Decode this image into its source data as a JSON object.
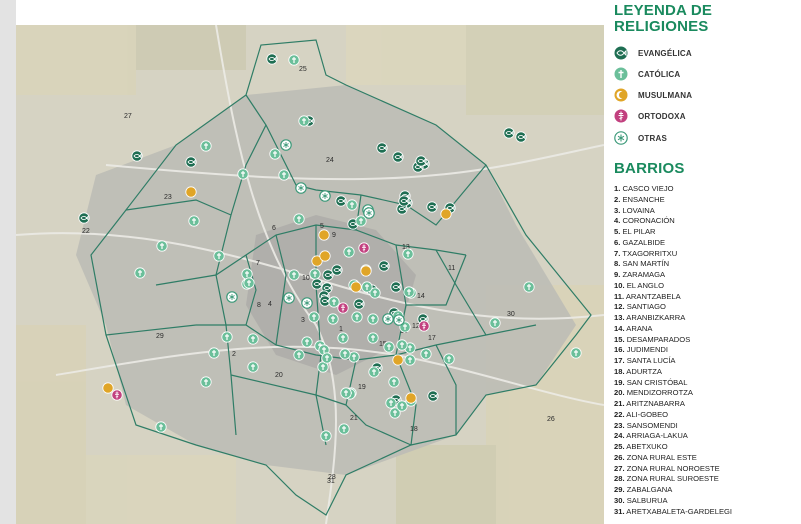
{
  "legend": {
    "title": "LEYENDA DE RELIGIONES",
    "items": [
      {
        "key": "evangelica",
        "label": "EVANGÉLICA",
        "color": "#1e6e52",
        "icon": "fish-icon"
      },
      {
        "key": "catolica",
        "label": "CATÓLICA",
        "color": "#6bbf9a",
        "icon": "cross-icon"
      },
      {
        "key": "musulmana",
        "label": "MUSULMANA",
        "color": "#e0a527",
        "icon": "crescent-icon"
      },
      {
        "key": "ortodoxa",
        "label": "ORTODOXA",
        "color": "#c2407f",
        "icon": "orthodox-cross-icon"
      },
      {
        "key": "otras",
        "label": "OTRAS",
        "color": "#3d9a7a",
        "icon": "asterisk-icon"
      }
    ]
  },
  "barrios_title": "BARRIOS",
  "barrios": [
    {
      "num": "1.",
      "name": "CASCO VIEJO"
    },
    {
      "num": "2.",
      "name": "ENSANCHE"
    },
    {
      "num": "3.",
      "name": "LOVAINA"
    },
    {
      "num": "4.",
      "name": "CORONACIÓN"
    },
    {
      "num": "5.",
      "name": "EL PILAR"
    },
    {
      "num": "6.",
      "name": "GAZALBIDE"
    },
    {
      "num": "7.",
      "name": "TXAGORRITXU"
    },
    {
      "num": "8.",
      "name": "SAN MARTÍN"
    },
    {
      "num": "9.",
      "name": "ZARAMAGA"
    },
    {
      "num": "10.",
      "name": "EL ANGLO"
    },
    {
      "num": "11.",
      "name": "ARANTZABELA"
    },
    {
      "num": "12.",
      "name": "SANTIAGO"
    },
    {
      "num": "13.",
      "name": "ARANBIZKARRA"
    },
    {
      "num": "14.",
      "name": "ARANA"
    },
    {
      "num": "15.",
      "name": "DESAMPARADOS"
    },
    {
      "num": "16.",
      "name": "JUDIMENDI"
    },
    {
      "num": "17.",
      "name": "SANTA LUCÍA"
    },
    {
      "num": "18.",
      "name": "ADURTZA"
    },
    {
      "num": "19.",
      "name": "SAN CRISTÓBAL"
    },
    {
      "num": "20.",
      "name": "MENDIZORROTZA"
    },
    {
      "num": "21.",
      "name": "ARITZNABARRA"
    },
    {
      "num": "22.",
      "name": "ALI-GOBEO"
    },
    {
      "num": "23.",
      "name": "SANSOMENDI"
    },
    {
      "num": "24.",
      "name": "ARRIAGA-LAKUA"
    },
    {
      "num": "25.",
      "name": "ABETXUKO"
    },
    {
      "num": "26.",
      "name": "ZONA RURAL ESTE"
    },
    {
      "num": "27.",
      "name": "ZONA RURAL NOROESTE"
    },
    {
      "num": "28.",
      "name": "ZONA RURAL SUROESTE"
    },
    {
      "num": "29.",
      "name": "ZABALGANA"
    },
    {
      "num": "30.",
      "name": "SALBURUA"
    },
    {
      "num": "31.",
      "name": "ARETXABALETA-GARDELEGI"
    }
  ],
  "map": {
    "district_labels": [
      "1",
      "2",
      "3",
      "4",
      "5",
      "6",
      "7",
      "8",
      "9",
      "10",
      "11",
      "12",
      "13",
      "14",
      "15",
      "16",
      "17",
      "18",
      "19",
      "20",
      "21",
      "22",
      "23",
      "24",
      "25",
      "26",
      "27",
      "28",
      "29",
      "30",
      "31"
    ],
    "markers": {
      "evangelica": 36,
      "catolica": 68,
      "musulmana": 10,
      "ortodoxa": 4,
      "otras": 10
    }
  }
}
